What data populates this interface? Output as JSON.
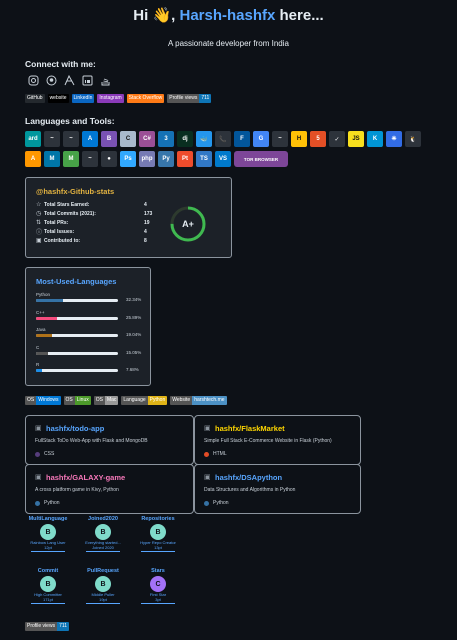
{
  "header": {
    "greeting": "Hi",
    "wave": "👋",
    "name": "Harsh-hashfx",
    "suffix": "here...",
    "tagline": "A passionate developer from India"
  },
  "connect": {
    "heading": "Connect with me:",
    "icons": [
      "instagram-icon",
      "github-icon",
      "settings-icon",
      "linkedin-icon",
      "stackoverflow-icon"
    ],
    "badges": [
      {
        "left": "GitHub",
        "right": "",
        "color": "#24292e"
      },
      {
        "left": "website",
        "right": "",
        "color": "#000000"
      },
      {
        "left": "LinkedIn",
        "right": "",
        "color": "#0a66c2"
      },
      {
        "left": "Instagram",
        "right": "",
        "color": "#8a3ab9"
      },
      {
        "left": "Stack Overflow",
        "right": "",
        "color": "#fe7a16"
      },
      {
        "left": "Profile views",
        "right": "711",
        "color": "#555555",
        "rcolor": "#0e75b6"
      }
    ]
  },
  "tools": {
    "heading": "Languages and Tools:",
    "row1": [
      {
        "label": "ard",
        "color": "#00979d"
      },
      {
        "label": "~",
        "color": "#2d333b"
      },
      {
        "label": "~",
        "color": "#2d333b"
      },
      {
        "label": "A",
        "color": "#0078d4"
      },
      {
        "label": "B",
        "color": "#7952b3"
      },
      {
        "label": "C",
        "color": "#a8b9cc"
      },
      {
        "label": "C#",
        "color": "#9b4f96"
      },
      {
        "label": "3",
        "color": "#1572b6"
      },
      {
        "label": "dj",
        "color": "#092e20"
      },
      {
        "label": "🐳",
        "color": "#2496ed"
      },
      {
        "label": "📞",
        "color": "#2d333b"
      },
      {
        "label": "F",
        "color": "#02569b"
      },
      {
        "label": "G",
        "color": "#4285f4"
      },
      {
        "label": "~",
        "color": "#2d333b"
      },
      {
        "label": "H",
        "color": "#ffc107"
      },
      {
        "label": "5",
        "color": "#e34f26"
      },
      {
        "label": "✓",
        "color": "#2d333b"
      },
      {
        "label": "JS",
        "color": "#f7df1e"
      },
      {
        "label": "K",
        "color": "#0095d5"
      },
      {
        "label": "⎈",
        "color": "#326ce5"
      },
      {
        "label": "🐧",
        "color": "#2d333b"
      }
    ],
    "row2": [
      {
        "label": "A",
        "color": "#ff9800"
      },
      {
        "label": "M",
        "color": "#0076a8"
      },
      {
        "label": "M",
        "color": "#47a248"
      },
      {
        "label": "~",
        "color": "#2d333b"
      },
      {
        "label": "●",
        "color": "#2d333b"
      },
      {
        "label": "Ps",
        "color": "#31a8ff"
      },
      {
        "label": "php",
        "color": "#777bb4"
      },
      {
        "label": "Py",
        "color": "#3776ab"
      },
      {
        "label": "Pt",
        "color": "#ee4c2c"
      },
      {
        "label": "TS",
        "color": "#3178c6"
      },
      {
        "label": "VS",
        "color": "#007acc"
      },
      {
        "label": "TOR BROWSER",
        "color": "#7d4698",
        "wide": true
      }
    ]
  },
  "stats": {
    "title": "@hashfx-Github-stats",
    "rows": [
      {
        "icon": "☆",
        "label": "Total Stars Earned:",
        "value": "4"
      },
      {
        "icon": "◷",
        "label": "Total Commits (2021):",
        "value": "173"
      },
      {
        "icon": "⇅",
        "label": "Total PRs:",
        "value": "19"
      },
      {
        "icon": "ⓘ",
        "label": "Total Issues:",
        "value": "4"
      },
      {
        "icon": "▣",
        "label": "Contributed to:",
        "value": "8"
      }
    ],
    "grade": "A+",
    "ring_color": "#3fb950",
    "ring_fraction": 0.75
  },
  "languages": {
    "title": "Most-Used-Languages",
    "items": [
      {
        "name": "Python",
        "pct": "32.34%",
        "value": 32.34,
        "color": "#3572a5"
      },
      {
        "name": "C++",
        "pct": "25.89%",
        "value": 25.89,
        "color": "#f34b7d"
      },
      {
        "name": "Java",
        "pct": "19.04%",
        "value": 19.04,
        "color": "#b07219"
      },
      {
        "name": "C",
        "pct": "15.05%",
        "value": 15.05,
        "color": "#555555"
      },
      {
        "name": "R",
        "pct": "7.68%",
        "value": 7.68,
        "color": "#198ce7"
      }
    ]
  },
  "os_badges": [
    {
      "left": "OS",
      "right": "Windows",
      "rcolor": "#0078d6"
    },
    {
      "left": "OS",
      "right": "Linux",
      "rcolor": "#4c9a2a"
    },
    {
      "left": "OS",
      "right": "Mac",
      "rcolor": "#999999"
    },
    {
      "left": "Language",
      "right": "Python",
      "rcolor": "#dfb317"
    },
    {
      "left": "Website",
      "right": "harshtech.me",
      "rcolor": "#4c91c5"
    }
  ],
  "repos": [
    {
      "name": "hashfx/todo-app",
      "desc": "FullStack ToDo Web-App with Flask and MongoDB",
      "lang": "CSS",
      "lang_color": "#563d7c",
      "name_color": "#58a6ff"
    },
    {
      "name": "hashfx/FlaskMarket",
      "desc": "Simple Full Stack E-Commerce Website in Flask (Python)",
      "lang": "HTML",
      "lang_color": "#e34c26",
      "name_color": "#ffd700"
    },
    {
      "name": "hashfx/GALAXY-game",
      "desc": "A cross platform game in Kivy, Python",
      "lang": "Python",
      "lang_color": "#3572a5",
      "name_color": "#f778ba"
    },
    {
      "name": "hashfx/DSApython",
      "desc": "Data Structures and Algorithms in Python",
      "lang": "Python",
      "lang_color": "#3572a5",
      "name_color": "#58a6ff"
    }
  ],
  "trophies": [
    {
      "title": "MultiLanguage",
      "rank": "B",
      "sub1": "Rainbow Lang User",
      "sub2": "",
      "pt": "12pt",
      "color": "#7fdbca"
    },
    {
      "title": "Joined2020",
      "rank": "B",
      "sub1": "Everything started...",
      "sub2": "Joined 2020",
      "pt": "",
      "color": "#7fdbca"
    },
    {
      "title": "Repositories",
      "rank": "B",
      "sub1": "Hyper Repo Creator",
      "sub2": "",
      "pt": "13pt",
      "color": "#7fdbca"
    },
    {
      "title": "Commit",
      "rank": "B",
      "sub1": "High Committer",
      "sub2": "",
      "pt": "171pt",
      "color": "#7fdbca"
    },
    {
      "title": "PullRequest",
      "rank": "B",
      "sub1": "Middle Puller",
      "sub2": "",
      "pt": "19pt",
      "color": "#7fdbca"
    },
    {
      "title": "Stars",
      "rank": "C",
      "sub1": "First Star",
      "sub2": "",
      "pt": "3pt",
      "color": "#a371f7"
    }
  ],
  "footer_badge": {
    "left": "Profile views",
    "right": "711",
    "rcolor": "#0e75b6"
  }
}
